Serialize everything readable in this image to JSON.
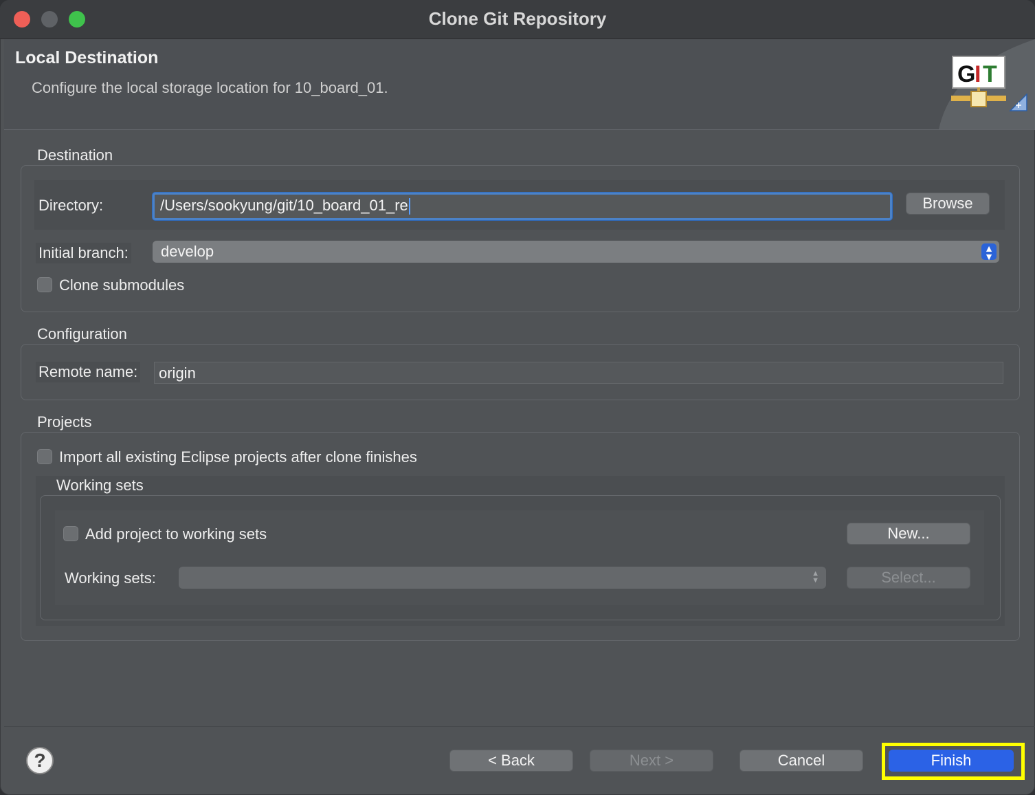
{
  "window": {
    "title": "Clone Git Repository"
  },
  "header": {
    "title": "Local Destination",
    "subtitle": "Configure the local storage location for 10_board_01.",
    "logo_text": "GIT"
  },
  "destination": {
    "group_label": "Destination",
    "directory_label": "Directory:",
    "directory_value": "/Users/sookyung/git/10_board_01_re",
    "browse_label": "Browse",
    "initial_branch_label": "Initial branch:",
    "initial_branch_value": "develop",
    "clone_submodules_label": "Clone submodules"
  },
  "configuration": {
    "group_label": "Configuration",
    "remote_name_label": "Remote name:",
    "remote_name_value": "origin"
  },
  "projects": {
    "group_label": "Projects",
    "import_label": "Import all existing Eclipse projects after clone finishes",
    "working_sets_group_label": "Working sets",
    "add_to_working_sets_label": "Add project to working sets",
    "new_label": "New...",
    "working_sets_label": "Working sets:",
    "working_sets_value": "",
    "select_label": "Select..."
  },
  "footer": {
    "help_icon": "?",
    "back_label": "< Back",
    "next_label": "Next >",
    "cancel_label": "Cancel",
    "finish_label": "Finish"
  },
  "colors": {
    "accent": "#2b62e6",
    "highlight": "#ffff00",
    "focus_ring": "#4b82c8"
  }
}
